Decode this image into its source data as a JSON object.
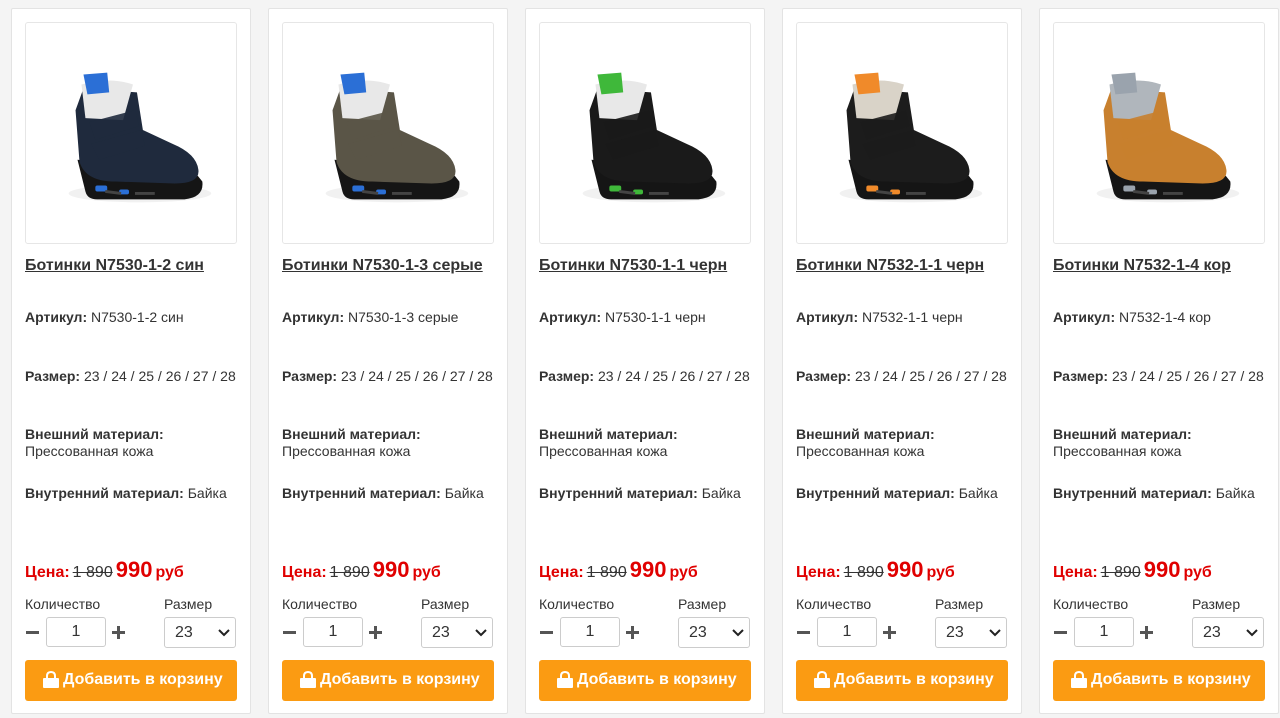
{
  "colors": {
    "accent_orange": "#fb9b12",
    "price_red": "#e00000",
    "text": "#333333",
    "border": "#e3e3e3"
  },
  "labels": {
    "article": "Артикул:",
    "size": "Размер:",
    "outer_material": "Внешний материал:",
    "inner_material": "Внутренний материал:",
    "price": "Цена:",
    "currency": "руб",
    "quantity": "Количество",
    "size_select": "Размер",
    "add_to_cart": "Добавить в корзину"
  },
  "icons": {
    "cart_button": "shopping-bag-icon",
    "decrement": "minus-icon",
    "increment": "plus-icon",
    "select": "chevron-down-icon"
  },
  "products": [
    {
      "title": "Ботинки N7530-1-2 син",
      "article": "N7530-1-2 син",
      "sizes": "23 / 24 / 25 / 26 / 27 / 28",
      "outer_material": "Прессованная кожа",
      "inner_material": "Байка",
      "old_price": "1 890",
      "new_price": "990",
      "quantity": "1",
      "selected_size": "23",
      "image": "boot-navy-blue",
      "body_color": "#1f2a3d",
      "accent_color": "#2b6fd6",
      "collar_color": "#e8e8e8"
    },
    {
      "title": "Ботинки N7530-1-3 серые",
      "article": "N7530-1-3 серые",
      "sizes": "23 / 24 / 25 / 26 / 27 / 28",
      "outer_material": "Прессованная кожа",
      "inner_material": "Байка",
      "old_price": "1 890",
      "new_price": "990",
      "quantity": "1",
      "selected_size": "23",
      "image": "boot-grey-brown",
      "body_color": "#5a5547",
      "accent_color": "#2b6fd6",
      "collar_color": "#e8e8e8"
    },
    {
      "title": "Ботинки N7530-1-1 черн",
      "article": "N7530-1-1 черн",
      "sizes": "23 / 24 / 25 / 26 / 27 / 28",
      "outer_material": "Прессованная кожа",
      "inner_material": "Байка",
      "old_price": "1 890",
      "new_price": "990",
      "quantity": "1",
      "selected_size": "23",
      "image": "boot-black-green",
      "body_color": "#1a1a1a",
      "accent_color": "#3fb83a",
      "collar_color": "#e8e8e8"
    },
    {
      "title": "Ботинки N7532-1-1 черн",
      "article": "N7532-1-1 черн",
      "sizes": "23 / 24 / 25 / 26 / 27 / 28",
      "outer_material": "Прессованная кожа",
      "inner_material": "Байка",
      "old_price": "1 890",
      "new_price": "990",
      "quantity": "1",
      "selected_size": "23",
      "image": "boot-black-orange",
      "body_color": "#1c1c1c",
      "accent_color": "#f08a2a",
      "collar_color": "#d9d3c8"
    },
    {
      "title": "Ботинки N7532-1-4 кор",
      "article": "N7532-1-4 кор",
      "sizes": "23 / 24 / 25 / 26 / 27 / 28",
      "outer_material": "Прессованная кожа",
      "inner_material": "Байка",
      "old_price": "1 890",
      "new_price": "990",
      "quantity": "1",
      "selected_size": "23",
      "image": "boot-tan-brown",
      "body_color": "#c8802e",
      "accent_color": "#9aa3ad",
      "collar_color": "#b0b6bc"
    }
  ]
}
